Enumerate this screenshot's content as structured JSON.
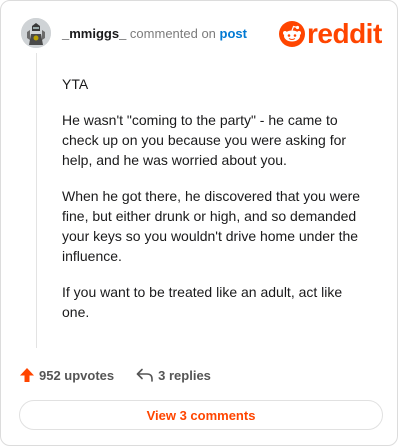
{
  "header": {
    "username": "_mmiggs_",
    "action_text": " commented on ",
    "post_link": "post"
  },
  "logo": {
    "wordmark": "reddit",
    "icon": "reddit-snoo-icon",
    "color": "#ff4500"
  },
  "avatar": {
    "icon": "user-avatar-knight-icon"
  },
  "comment": {
    "paragraphs": [
      "YTA",
      "He wasn't \"coming to the party\" - he came to check up on you because you were asking for help, and he was worried about you.",
      "When he got there, he discovered that you were fine, but either drunk or high, and so demanded your keys so you wouldn't drive home under the influence.",
      "If you want to be treated like an adult, act like one."
    ]
  },
  "actions": {
    "upvotes": "952 upvotes",
    "upvote_icon": "upvote-arrow-icon",
    "replies": "3 replies",
    "reply_icon": "reply-arrow-icon"
  },
  "view_comments": {
    "label": "View 3 comments"
  },
  "colors": {
    "accent": "#ff4500",
    "link": "#0079d3",
    "text": "#1a1a1b",
    "muted": "#7c7c7c"
  }
}
